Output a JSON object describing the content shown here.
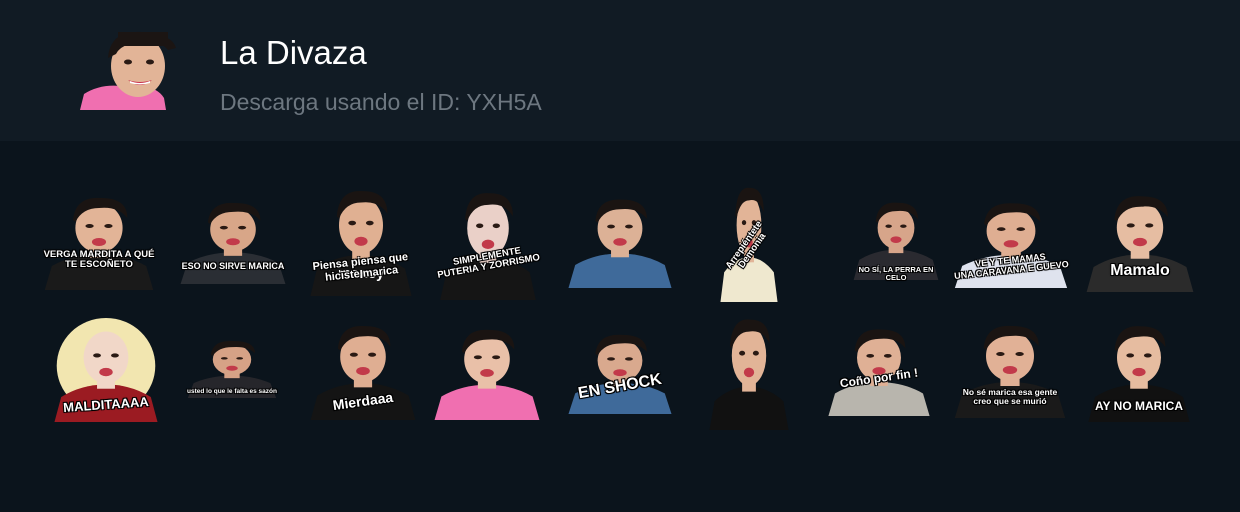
{
  "pack": {
    "title": "La Divaza",
    "subtitle": "Descarga usando el ID: YXH5A",
    "thumbnail_icon": "person-pink-shirt-icon"
  },
  "stickers": [
    {
      "caption": "VERGA MARDITA A QUÉ\nTE ESCOÑETO",
      "shirt": "#1a1a1a"
    },
    {
      "caption": "ESO NO SIRVE MARICA",
      "shirt": "#2a2e34"
    },
    {
      "caption": "Piensa piensa que\nhiciste marica",
      "shirt": "#161616",
      "shirt_text": "money"
    },
    {
      "caption": "SIMPLEMENTE\nPUTERIA Y ZORRISMO",
      "shirt": "#151515"
    },
    {
      "caption": "",
      "shirt": "#3f6a9a"
    },
    {
      "caption": "Arrepiéntete\nDemonia",
      "shirt": "#efe8cf"
    },
    {
      "caption": "NO SÍ, LA PERRA EN CELO",
      "shirt": "#2a2a30"
    },
    {
      "caption": "VE Y TE MAMAS\nUNA CARAVANA E GUEVO",
      "shirt": "#dfe3ee"
    },
    {
      "caption": "Mamalo",
      "shirt": "#2b2b2b"
    },
    {
      "caption": "MALDITAAAA",
      "shirt": "#9b1b22"
    },
    {
      "caption": "usted lo que le falta es sazón",
      "shirt": "#26262b"
    },
    {
      "caption": "Mierdaaa",
      "shirt": "#141414"
    },
    {
      "caption": "",
      "shirt": "#f06fb0"
    },
    {
      "caption": "EN SHOCK",
      "shirt": "#3f6a9a"
    },
    {
      "caption": "",
      "shirt": "#111111"
    },
    {
      "caption": "Coño por fin !",
      "shirt": "#b8b5ad"
    },
    {
      "caption": "No sé marica esa gente\ncreo que se murió",
      "shirt": "#1a1a1a"
    },
    {
      "caption": "AY NO MARICA",
      "shirt": "#111111"
    }
  ]
}
